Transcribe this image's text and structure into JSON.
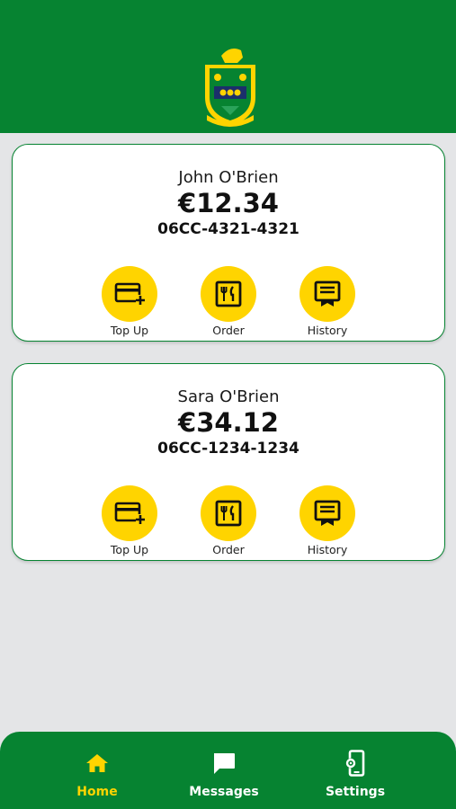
{
  "colors": {
    "primary_green": "#068331",
    "accent_yellow": "#ffd400",
    "background": "#e4e5e7",
    "card": "#ffffff"
  },
  "header": {
    "logo_icon": "school-crest-icon"
  },
  "accounts": [
    {
      "name": "John O'Brien",
      "balance": "€12.34",
      "card_number": "06CC-4321-4321",
      "actions": [
        {
          "label": "Top Up",
          "icon": "credit-card-plus-icon"
        },
        {
          "label": "Order",
          "icon": "restaurant-menu-icon"
        },
        {
          "label": "History",
          "icon": "receipt-history-icon"
        }
      ]
    },
    {
      "name": "Sara O'Brien",
      "balance": "€34.12",
      "card_number": "06CC-1234-1234",
      "actions": [
        {
          "label": "Top Up",
          "icon": "credit-card-plus-icon"
        },
        {
          "label": "Order",
          "icon": "restaurant-menu-icon"
        },
        {
          "label": "History",
          "icon": "receipt-history-icon"
        }
      ]
    }
  ],
  "bottom_nav": {
    "items": [
      {
        "label": "Home",
        "icon": "home-icon",
        "active": true
      },
      {
        "label": "Messages",
        "icon": "chat-icon",
        "active": false
      },
      {
        "label": "Settings",
        "icon": "phone-settings-icon",
        "active": false
      }
    ]
  }
}
